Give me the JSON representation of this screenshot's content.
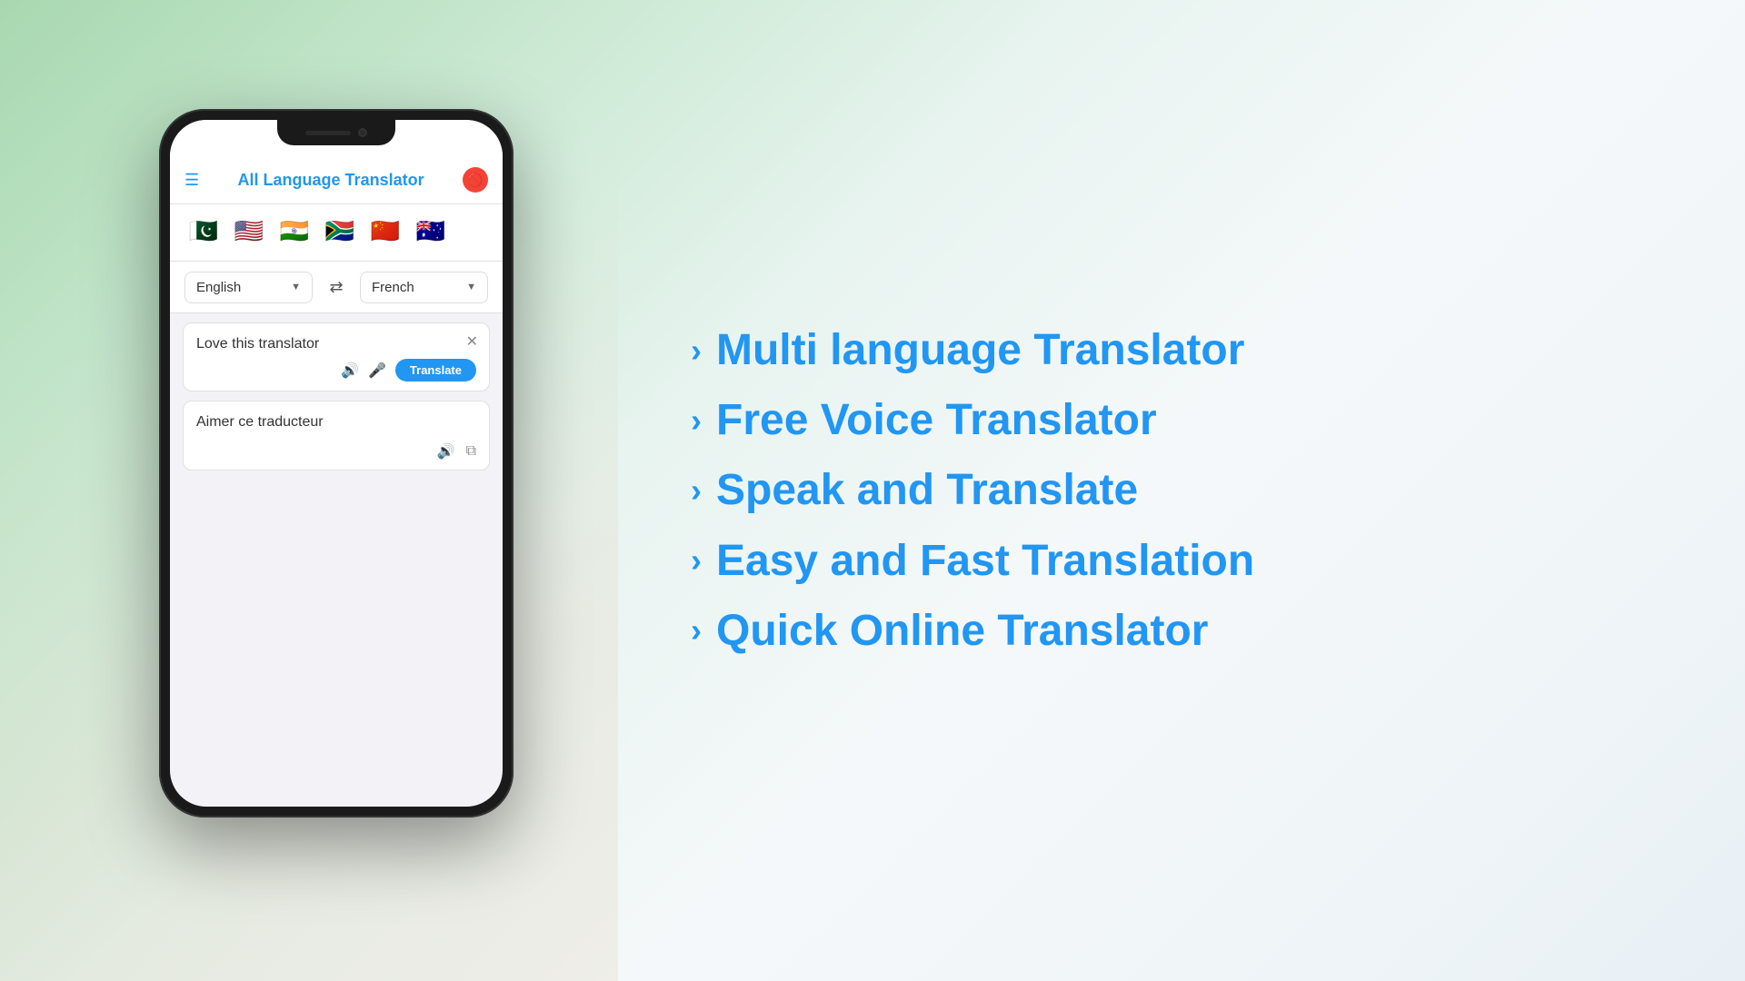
{
  "app": {
    "title": "All Language Translator",
    "header": {
      "menu_label": "menu",
      "no_icon_label": "🚫"
    },
    "flags": [
      {
        "emoji": "🇵🇰",
        "label": "Pakistan flag"
      },
      {
        "emoji": "🇺🇸",
        "label": "United States flag"
      },
      {
        "emoji": "🇮🇳",
        "label": "India flag"
      },
      {
        "emoji": "🇿🇦",
        "label": "South Africa flag"
      },
      {
        "emoji": "🇨🇳",
        "label": "China flag"
      },
      {
        "emoji": "🇦🇺",
        "label": "Australia flag"
      }
    ],
    "language_selector": {
      "source_lang": "English",
      "target_lang": "French",
      "swap_symbol": "⇄"
    },
    "input": {
      "text": "Love this translator",
      "close_symbol": "✕",
      "speaker_symbol": "🔊",
      "mic_symbol": "🎤",
      "translate_btn": "Translate"
    },
    "output": {
      "text": "Aimer ce traducteur",
      "speaker_symbol": "🔊",
      "copy_symbol": "⧉"
    }
  },
  "features": [
    {
      "text": "Multi language Translator"
    },
    {
      "text": "Free Voice Translator"
    },
    {
      "text": "Speak and Translate"
    },
    {
      "text": "Easy and Fast Translation"
    },
    {
      "text": "Quick Online Translator"
    }
  ],
  "colors": {
    "primary": "#2196F3",
    "background_start": "#a8d8b0",
    "background_end": "#e8f0f5"
  }
}
